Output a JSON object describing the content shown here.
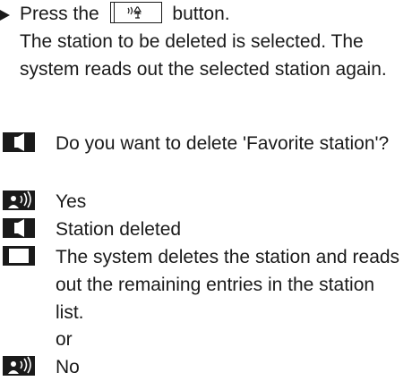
{
  "step": {
    "before_button": "Press the",
    "after_button": "button.",
    "button_icon": "voice-control-icon",
    "description": "The station to be deleted is selected. The system reads out the selected station again."
  },
  "dialog": [
    {
      "icon": "speaker-icon",
      "text": "Do you want to delete 'Favorite station'?"
    },
    {
      "icon": "person-speaking-icon",
      "text": "Yes"
    },
    {
      "icon": "speaker-icon",
      "text": "Station deleted"
    },
    {
      "icon": "display-icon",
      "text": "The system deletes the station and reads out the remaining entries in the station list."
    },
    {
      "icon": "person-speaking-icon",
      "text": "No"
    }
  ],
  "or_label": "or"
}
